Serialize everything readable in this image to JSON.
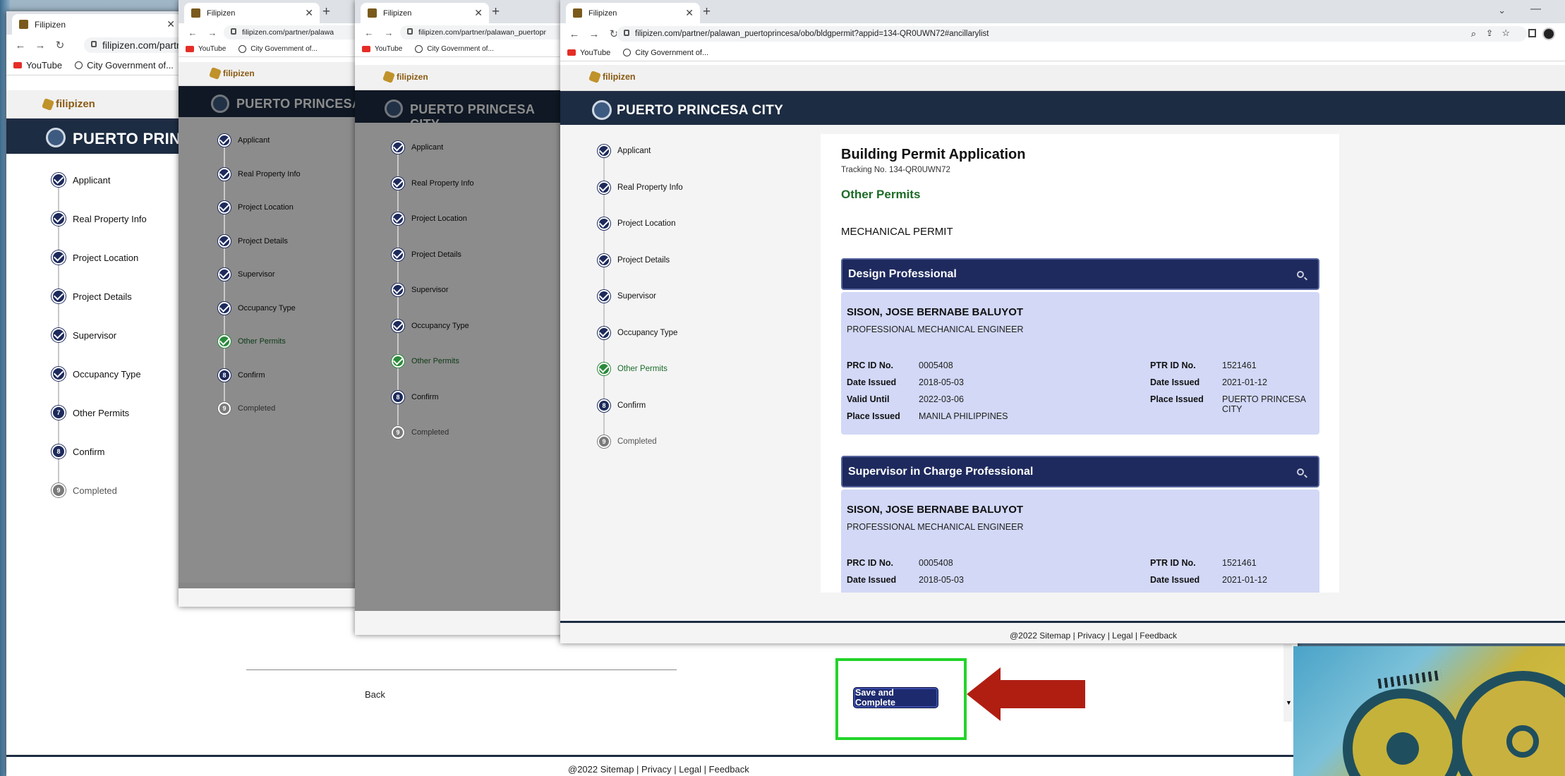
{
  "browser": {
    "tab_title": "Filipizen",
    "address_url": "filipizen.com/partner/palawan_puertoprincesa/obo/bldgpermit?appid=134-QR0UWN72#ancillarylist",
    "address_url_short1": "filipizen.com/partr",
    "address_url_short2": "filipizen.com/partner/palawa",
    "address_url_short3": "filipizen.com/partner/palawan_puertopr",
    "bookmark_youtube": "YouTube",
    "bookmark_city": "City Government of..."
  },
  "site": {
    "brand": "filipizen",
    "city_name": "PUERTO PRINCESA CITY",
    "city_name_clip": "PUERTO PRINCE",
    "city_name_clip2": "PUERTO PRINCESA"
  },
  "steps": [
    {
      "label": "Applicant",
      "state": "done"
    },
    {
      "label": "Real Property Info",
      "state": "done"
    },
    {
      "label": "Project Location",
      "state": "done"
    },
    {
      "label": "Project Details",
      "state": "done"
    },
    {
      "label": "Supervisor",
      "state": "done"
    },
    {
      "label": "Occupancy Type",
      "state": "done"
    },
    {
      "label": "Other Permits",
      "state": "active",
      "num": "7"
    },
    {
      "label": "Confirm",
      "state": "upcoming",
      "num": "8"
    },
    {
      "label": "Completed",
      "state": "pending",
      "num": "9"
    }
  ],
  "application": {
    "title": "Building Permit Application",
    "tracking": "Tracking No. 134-QR0UWN72",
    "section": "Other Permits",
    "permit_type": "MECHANICAL PERMIT",
    "design_header": "Design Professional",
    "supervisor_header": "Supervisor in Charge Professional",
    "professional": {
      "name": "SISON, JOSE BERNABE BALUYOT",
      "title": "PROFESSIONAL MECHANICAL ENGINEER",
      "prc_label": "PRC ID No.",
      "prc_value": "0005408",
      "date_issued_label": "Date Issued",
      "date_issued_value": "2018-05-03",
      "valid_until_label": "Valid Until",
      "valid_until_value": "2022-03-06",
      "place_issued_label": "Place Issued",
      "place_issued_value": "MANILA PHILIPPINES",
      "ptr_label": "PTR ID No.",
      "ptr_value": "1521461",
      "ptr_date_label": "Date Issued",
      "ptr_date_value": "2021-01-12",
      "ptr_place_label": "Place Issued",
      "ptr_place_value": "PUERTO PRINCESA CITY"
    }
  },
  "footer": {
    "text": "@2022 Sitemap | Privacy | Legal | Feedback",
    "back": "Back",
    "save": "Save and Complete"
  },
  "colors": {
    "nav_dark": "#1c2c42",
    "step_active": "#2a8a3a",
    "highlight_box": "#22d42a",
    "arrow": "#b01e12"
  }
}
